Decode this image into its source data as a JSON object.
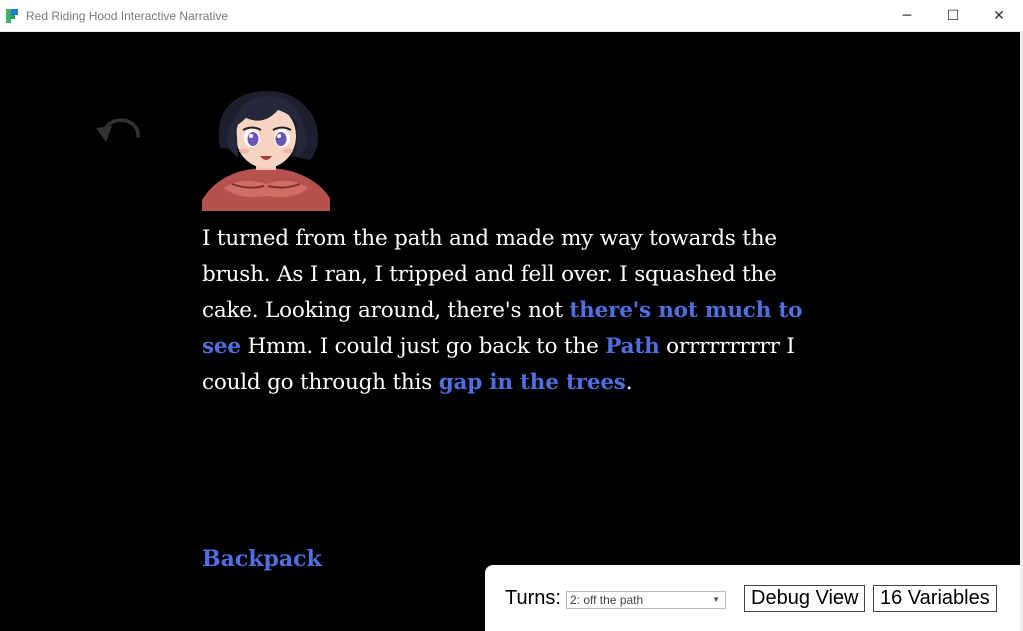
{
  "window": {
    "title": "Red Riding Hood Interactive Narrative",
    "minimize_glyph": "─",
    "maximize_glyph": "☐",
    "close_glyph": "✕"
  },
  "passage": {
    "t1": "I turned from the path and made my way towards the brush. As I ran, I tripped and fell over. I squashed the cake. Looking around, there's not ",
    "link1": "there's not much to see",
    "t2": " Hmm. I could just go back to the ",
    "link2": "Path",
    "t3": " orrrrrrrrrr I could go through this ",
    "link3": "gap in the trees",
    "t4": "."
  },
  "backpack": {
    "label": "Backpack"
  },
  "debug": {
    "turns_label": "Turns:",
    "turns_selected": "2: off the path",
    "debug_view_label": "Debug View",
    "variables_label": "16 Variables"
  },
  "colors": {
    "link": "#4f6fe0",
    "background": "#000000",
    "text": "#ffffff"
  },
  "icons": [
    "app-icon",
    "undo-icon",
    "chevron-down-icon"
  ]
}
